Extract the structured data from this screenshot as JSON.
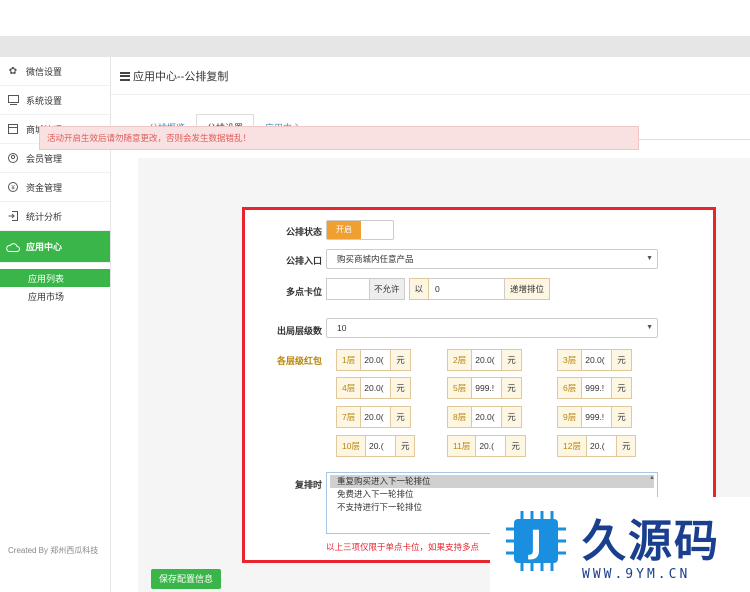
{
  "sidebar": {
    "items": [
      {
        "label": "微信设置",
        "icon": "gear-icon"
      },
      {
        "label": "系统设置",
        "icon": "monitor-icon"
      },
      {
        "label": "商城管理",
        "icon": "box-icon"
      },
      {
        "label": "会员管理",
        "icon": "user-icon"
      },
      {
        "label": "资金管理",
        "icon": "yen-icon"
      },
      {
        "label": "统计分析",
        "icon": "exit-icon"
      },
      {
        "label": "应用中心",
        "icon": "cloud-icon"
      }
    ],
    "sub_items": [
      "应用列表",
      "应用市场"
    ],
    "created_by": "Created By 郑州西瓜科技"
  },
  "header": {
    "title": "应用中心--公排复制"
  },
  "tabs": [
    "公排概览",
    "公排设置",
    "应用中心"
  ],
  "alert": "活动开启生效后请勿随意更改，否则会发生数据错乱！",
  "form": {
    "status_label": "公排状态",
    "status_on": "开启",
    "entry_label": "公排入口",
    "entry_value": "购买商城内任意产品",
    "multi_label": "多点卡位",
    "multi_not_allowed": "不允许",
    "multi_by": "以",
    "multi_value": "0",
    "multi_suffix": "递增排位",
    "exit_label": "出局层级数",
    "exit_value": "10",
    "redpack_label": "各层级红包",
    "levels": [
      {
        "label": "1层",
        "value": "20.0(",
        "unit": "元"
      },
      {
        "label": "2层",
        "value": "20.0(",
        "unit": "元"
      },
      {
        "label": "3层",
        "value": "20.0(",
        "unit": "元"
      },
      {
        "label": "4层",
        "value": "20.0(",
        "unit": "元"
      },
      {
        "label": "5层",
        "value": "999.!",
        "unit": "元"
      },
      {
        "label": "6层",
        "value": "999.!",
        "unit": "元"
      },
      {
        "label": "7层",
        "value": "20.0(",
        "unit": "元"
      },
      {
        "label": "8层",
        "value": "20.0(",
        "unit": "元"
      },
      {
        "label": "9层",
        "value": "999.!",
        "unit": "元"
      },
      {
        "label": "10层",
        "value": "20.(",
        "unit": "元"
      },
      {
        "label": "11层",
        "value": "20.(",
        "unit": "元"
      },
      {
        "label": "12层",
        "value": "20.(",
        "unit": "元"
      }
    ],
    "repeat_label": "复排时",
    "repeat_options": [
      "重复购买进入下一轮排位",
      "免费进入下一轮排位",
      "不支持进行下一轮排位"
    ],
    "hint": "以上三项仅限于单点卡位，如果支持多点"
  },
  "save_label": "保存配置信息",
  "watermark": {
    "logo_letter": "J",
    "text": "久源码",
    "url": "WWW.9YM.CN"
  },
  "colors": {
    "accent": "#3ab54a",
    "warning": "#f0a030",
    "highlight_box": "#e8252d"
  }
}
